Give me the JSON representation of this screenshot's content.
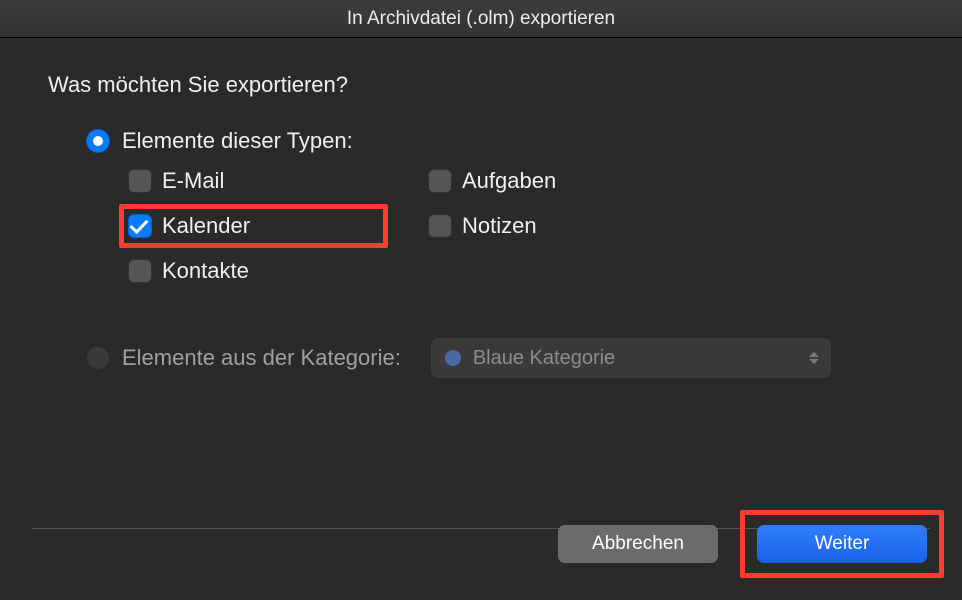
{
  "window": {
    "title": "In Archivdatei (.olm) exportieren"
  },
  "prompt": "Was möchten Sie exportieren?",
  "option_types": {
    "label": "Elemente dieser Typen:",
    "selected": true
  },
  "types": {
    "email": "E-Mail",
    "calendar": "Kalender",
    "contacts": "Kontakte",
    "tasks": "Aufgaben",
    "notes": "Notizen"
  },
  "checked": {
    "email": false,
    "calendar": true,
    "contacts": false,
    "tasks": false,
    "notes": false
  },
  "option_category": {
    "label": "Elemente aus der Kategorie:",
    "selected": false
  },
  "category_dropdown": {
    "value": "Blaue Kategorie"
  },
  "buttons": {
    "cancel": "Abbrechen",
    "next": "Weiter"
  }
}
